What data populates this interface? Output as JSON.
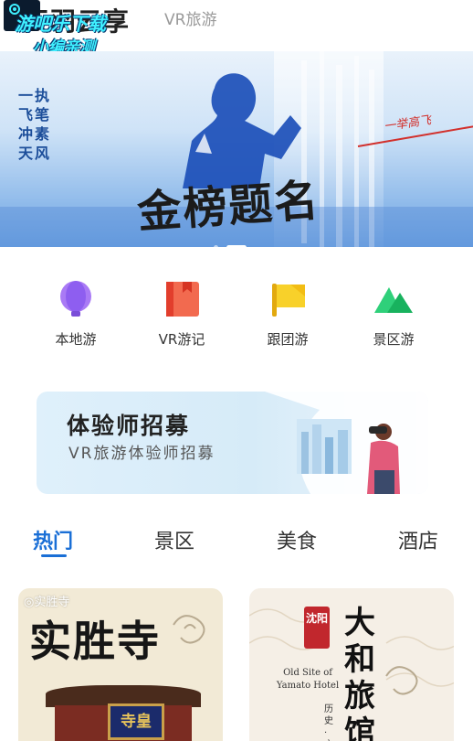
{
  "header": {
    "app_title": "天羽云享",
    "subtitle": "VR旅游",
    "watermark_line1": "游吧乐下载",
    "watermark_line2": "小编亲测"
  },
  "banner": {
    "vertical_text": [
      "一执",
      "飞笔",
      "冲素",
      "天风"
    ],
    "title": "金榜题名",
    "signature": "一举高飞",
    "dots": 2,
    "active_dot": 1
  },
  "quick_nav": [
    {
      "label": "本地游",
      "icon": "balloon-icon",
      "color": "#9b6cf0"
    },
    {
      "label": "VR游记",
      "icon": "notebook-icon",
      "color": "#f0533c"
    },
    {
      "label": "跟团游",
      "icon": "flag-icon",
      "color": "#f5c51c"
    },
    {
      "label": "景区游",
      "icon": "mountain-icon",
      "color": "#22c16a"
    }
  ],
  "recruit": {
    "title": "体验师招募",
    "subtitle": "VR旅游体验师招募"
  },
  "tabs": [
    {
      "label": "热门",
      "active": true
    },
    {
      "label": "景区",
      "active": false
    },
    {
      "label": "美食",
      "active": false
    },
    {
      "label": "酒店",
      "active": false
    }
  ],
  "cards": [
    {
      "tag": "◎实胜寺",
      "big_title": "实胜寺",
      "placard": "寺皇"
    },
    {
      "seal": "沈阳",
      "vertical_title": [
        "大",
        "和",
        "旅",
        "馆"
      ],
      "english": "Old Site of Yamato Hotel",
      "small_vertical": "历史·文"
    }
  ],
  "colors": {
    "accent": "#1a6fd6",
    "banner_blue": "#6aa3e3"
  }
}
